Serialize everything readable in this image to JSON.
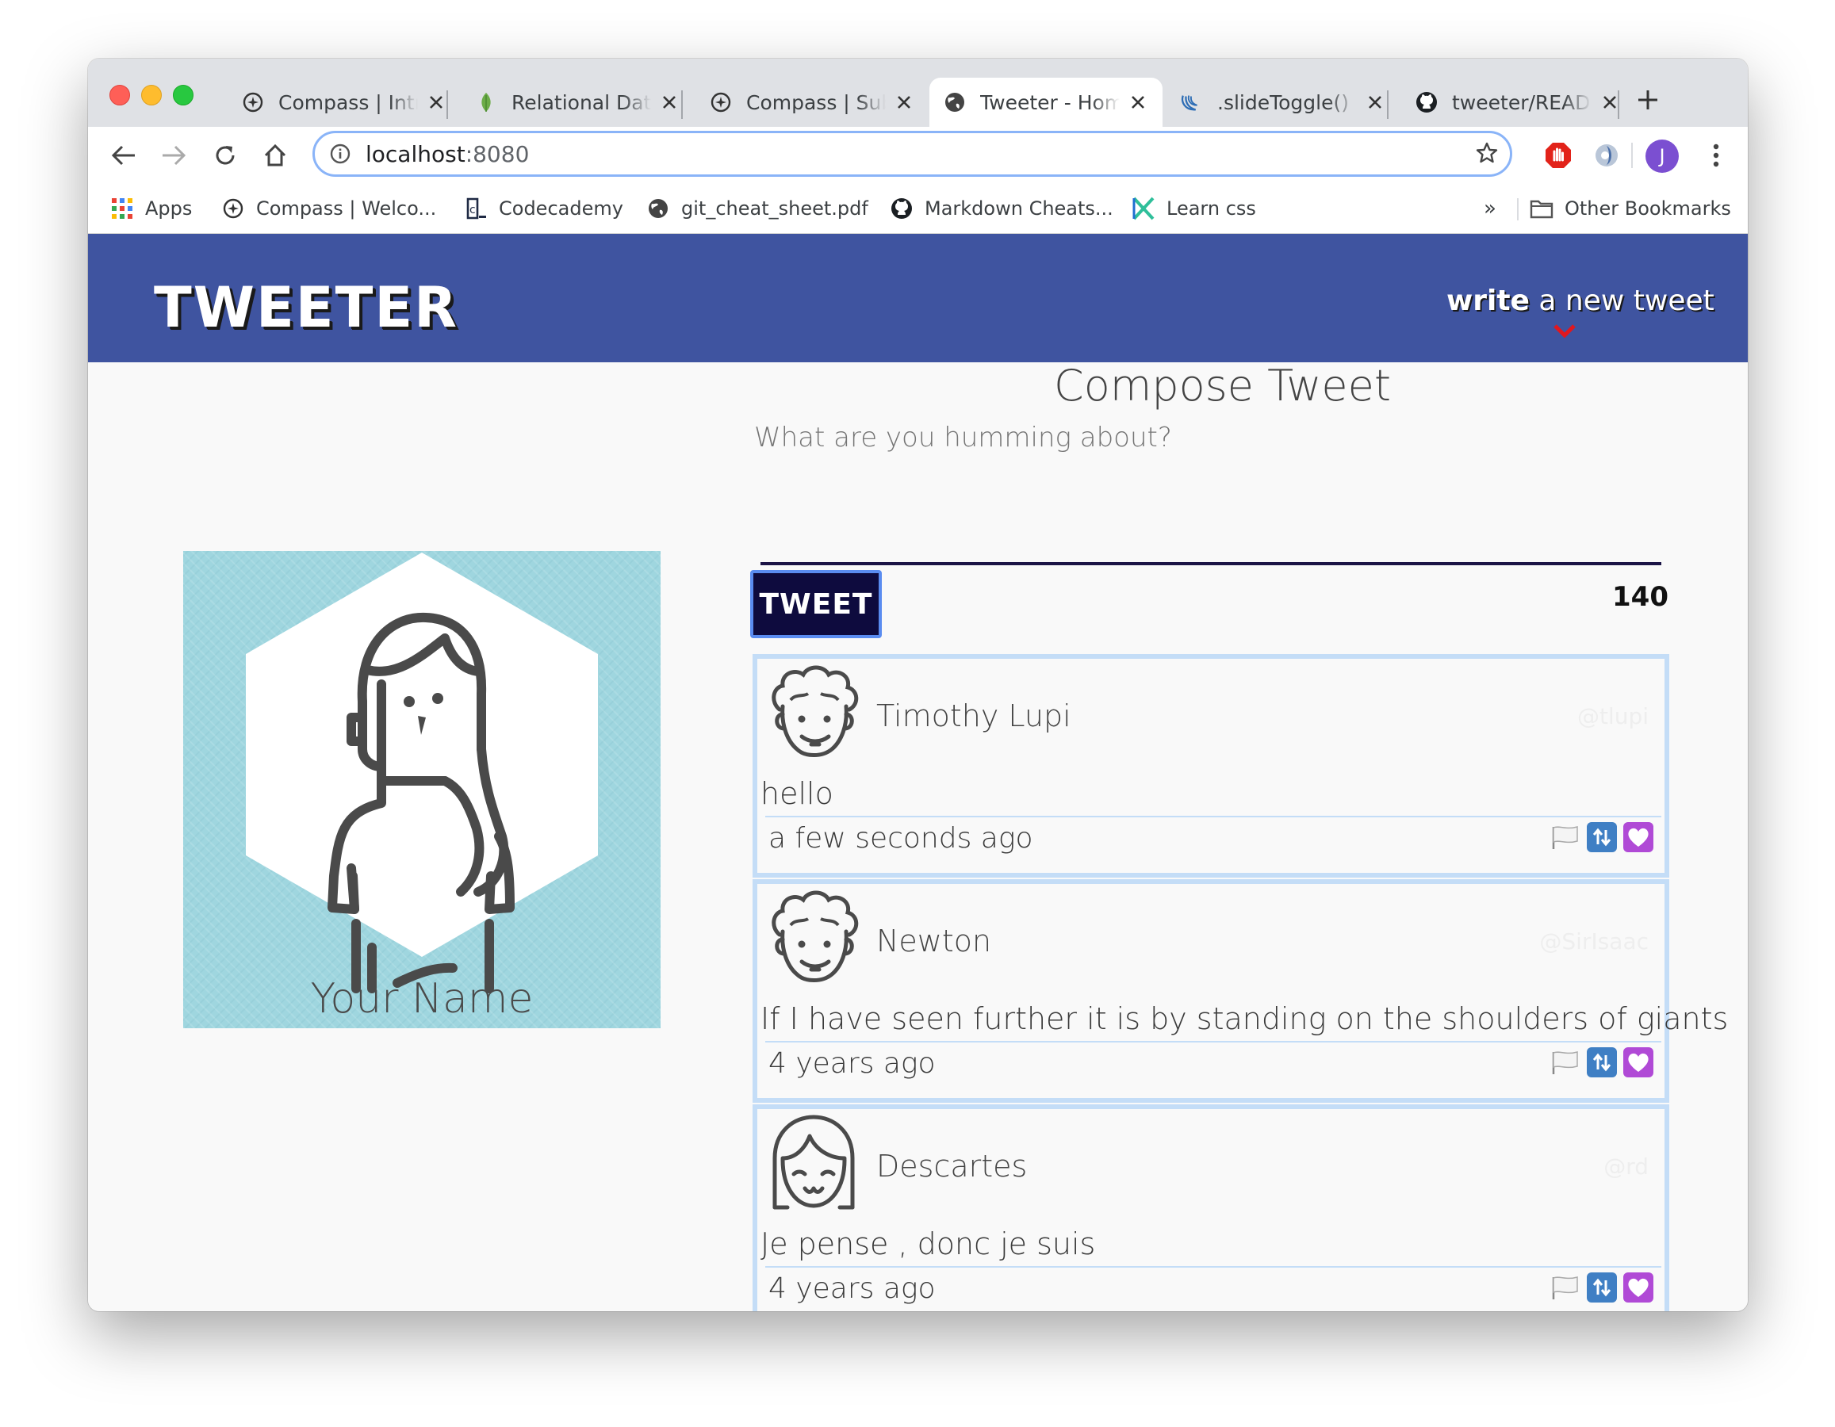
{
  "browser": {
    "tabs": [
      {
        "title": "Compass | Intr",
        "icon": "compass-icon"
      },
      {
        "title": "Relational Data",
        "icon": "mongodb-leaf-icon"
      },
      {
        "title": "Compass | Sub",
        "icon": "compass-icon"
      },
      {
        "title": "Tweeter - Hom",
        "icon": "globe-icon",
        "active": true
      },
      {
        "title": ".slideToggle() |",
        "icon": "jquery-icon"
      },
      {
        "title": "tweeter/READI",
        "icon": "github-icon"
      }
    ],
    "address": {
      "host": "localhost",
      "port": ":8080"
    },
    "profile_initial": "J",
    "bookmarks": [
      {
        "label": "Apps",
        "icon": "apps-grid-icon"
      },
      {
        "label": "Compass | Welco...",
        "icon": "compass-icon"
      },
      {
        "label": "Codecademy",
        "icon": "codecademy-icon"
      },
      {
        "label": "git_cheat_sheet.pdf",
        "icon": "globe-icon"
      },
      {
        "label": "Markdown Cheats...",
        "icon": "github-icon"
      },
      {
        "label": "Learn css",
        "icon": "css-x-icon"
      }
    ],
    "bookmarks_more": "»",
    "other_bookmarks": "Other Bookmarks"
  },
  "site": {
    "logo": "TWEETER",
    "nav": {
      "write_bold": "write",
      "write_rest": " a new tweet"
    },
    "colors": {
      "header": "#3f54a0",
      "tweet_border": "#c4ddf7",
      "button": "#0e0b3e"
    }
  },
  "profile": {
    "name": "Your Name"
  },
  "compose": {
    "title": "Compose Tweet",
    "placeholder": "What are you humming about?",
    "button": "TWEET",
    "counter": "140"
  },
  "tweets": [
    {
      "name": "Timothy Lupi",
      "handle": "@tlupi",
      "body": "hello",
      "time": "a few seconds ago"
    },
    {
      "name": "Newton",
      "handle": "@SirIsaac",
      "body": "If I have seen further it is by standing on the shoulders of giants",
      "time": "4 years ago"
    },
    {
      "name": "Descartes",
      "handle": "@rd",
      "body": "Je pense , donc je suis",
      "time": "4 years ago"
    }
  ]
}
